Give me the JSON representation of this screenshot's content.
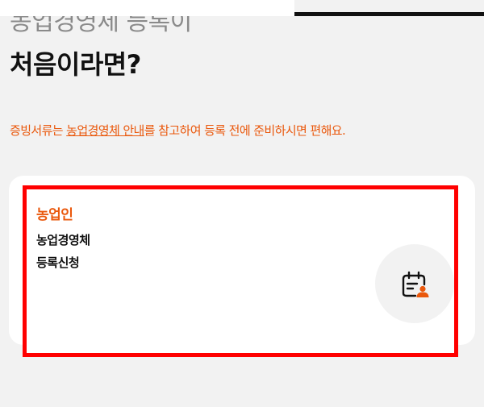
{
  "heading": {
    "line1": "농업경영체 등록이",
    "line2": "처음이라면?"
  },
  "notice": {
    "prefix": "증빙서류는 ",
    "link": "농업경영체 안내",
    "suffix": "를 참고하여 등록 전에 준비하시면 편해요."
  },
  "card": {
    "title": "농업인",
    "line1": "농업경영체",
    "line2": "등록신청",
    "icon": "calendar-user-icon"
  },
  "colors": {
    "accent": "#ea580c",
    "highlight_border": "#ff0000",
    "background": "#f2f2f2"
  }
}
